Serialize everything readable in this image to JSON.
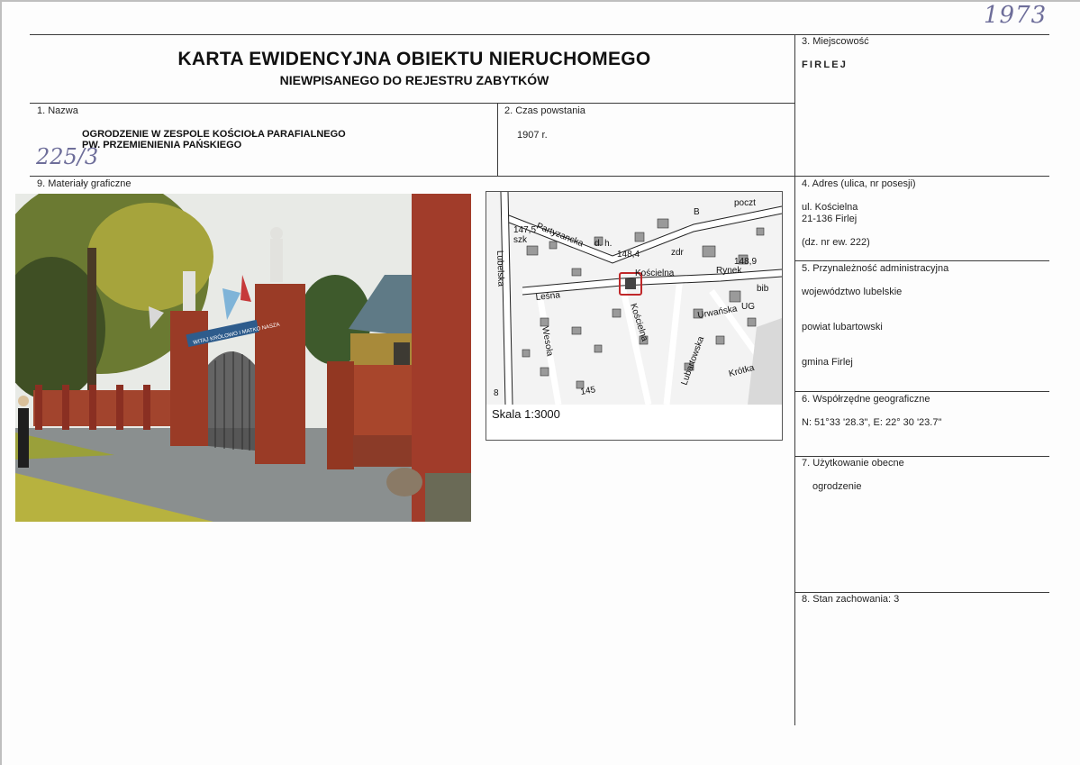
{
  "header": {
    "title": "KARTA EWIDENCYJNA OBIEKTU NIERUCHOMEGO",
    "subtitle": "NIEWPISANEGO DO REJESTRU ZABYTKÓW",
    "archive_number": "1973"
  },
  "fields": {
    "nazwa": {
      "label": "1. Nazwa",
      "line1": "OGRODZENIE W ZESPOLE KOŚCIOŁA PARAFIALNEGO",
      "line2": "PW. PRZEMIENIENIA PAŃSKIEGO",
      "handwritten_ref": "225/3"
    },
    "czas_powstania": {
      "label": "2. Czas powstania",
      "value": "1907 r."
    },
    "miejscowosc": {
      "label": "3. Miejscowość",
      "value": "FIRLEJ"
    },
    "adres": {
      "label": "4. Adres (ulica, nr posesji)",
      "street": "ul. Kościelna",
      "postal": "21-136 Firlej",
      "parcel": "(dz. nr ew. 222)"
    },
    "przynaleznosc": {
      "label": "5. Przynależność administracyjna",
      "wojewodztwo": "województwo  lubelskie",
      "powiat": "powiat lubartowski",
      "gmina": "gmina Firlej"
    },
    "wspolrzedne": {
      "label": "6. Współrzędne geograficzne",
      "value": "N: 51°33 '28.3\",  E: 22° 30 '23.7\""
    },
    "uzytkowanie": {
      "label": "7. Użytkowanie obecne",
      "value": "ogrodzenie"
    },
    "stan": {
      "label": "8. Stan zachowania:  3"
    },
    "materialy": {
      "label": "9. Materiały graficzne"
    }
  },
  "photo": {
    "banner_text": "WITAJ KRÓLOWO I MATKO NASZA"
  },
  "map": {
    "scale": "Skala 1:3000",
    "labels": [
      {
        "text": "147,5"
      },
      {
        "text": "szk"
      },
      {
        "text": "Partyzancka"
      },
      {
        "text": "Lubelska"
      },
      {
        "text": "d. h."
      },
      {
        "text": "148,4"
      },
      {
        "text": "Kościelna"
      },
      {
        "text": "Leśna"
      },
      {
        "text": "Rynek"
      },
      {
        "text": "148,9"
      },
      {
        "text": "Urwańska"
      },
      {
        "text": "Lubartowska"
      },
      {
        "text": "Kościelna"
      },
      {
        "text": "Krótka"
      },
      {
        "text": "Wesoła"
      },
      {
        "text": "UG"
      },
      {
        "text": "poczt"
      },
      {
        "text": "zdr"
      },
      {
        "text": "bib"
      },
      {
        "text": "B"
      },
      {
        "text": "8"
      },
      {
        "text": "145"
      }
    ]
  }
}
